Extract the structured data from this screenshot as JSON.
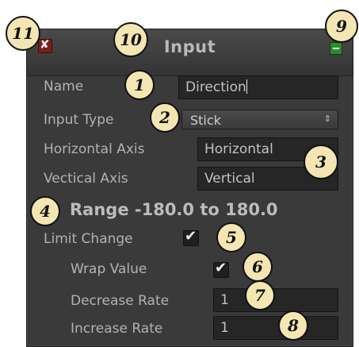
{
  "window": {
    "title": "Input"
  },
  "fields": {
    "name_label": "Name",
    "name_value": "Direction",
    "input_type_label": "Input Type",
    "input_type_value": "Stick",
    "input_type_arrow": "⇕",
    "horizontal_axis_label": "Horizontal Axis",
    "horizontal_axis_value": "Horizontal",
    "vertical_axis_label": "Vectical Axis",
    "vertical_axis_value": "Vertical",
    "range_text": "Range -180.0 to 180.0",
    "limit_change_label": "Limit Change",
    "limit_change_checked": true,
    "wrap_value_label": "Wrap Value",
    "wrap_value_checked": true,
    "decrease_rate_label": "Decrease Rate",
    "decrease_rate_value": "1",
    "increase_rate_label": "Increase Rate",
    "increase_rate_value": "1"
  },
  "callouts": [
    "1",
    "2",
    "3",
    "4",
    "5",
    "6",
    "7",
    "8",
    "9",
    "10",
    "11"
  ],
  "colors": {
    "panel": "#3a3a3a",
    "field": "#262626",
    "close": "#7a1e1e",
    "collapse": "#2e8a2e",
    "badge": "#f3e6b3"
  }
}
